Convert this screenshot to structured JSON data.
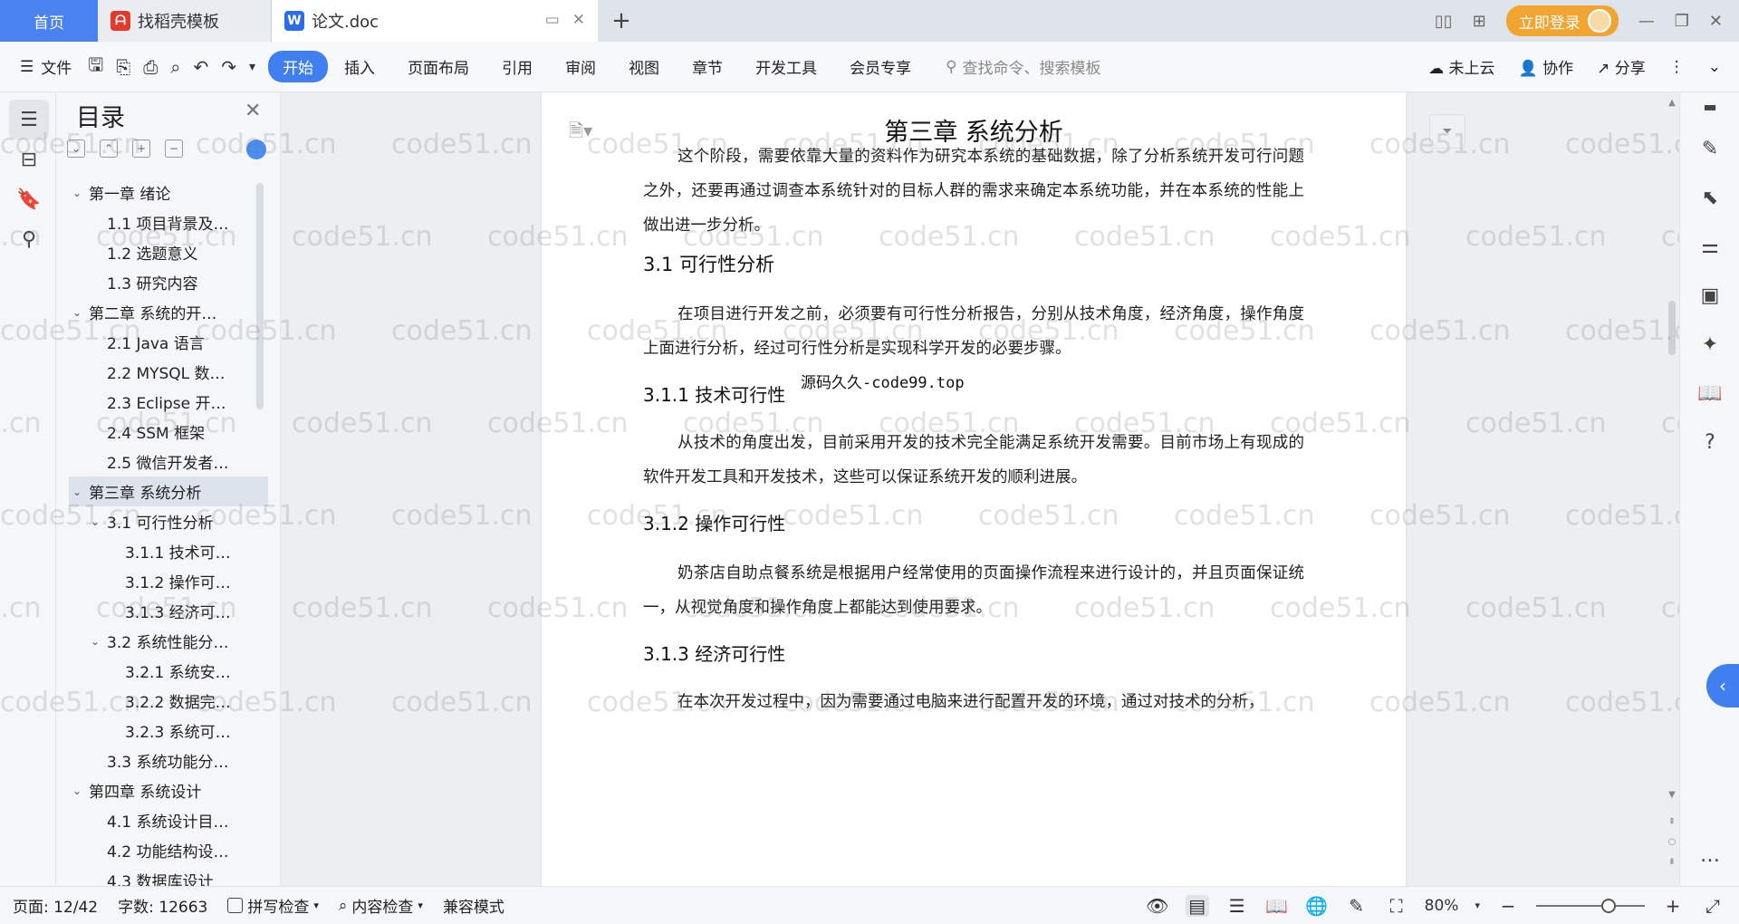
{
  "tabs": {
    "home": "首页",
    "template": "找稻壳模板",
    "doc": "论文.doc",
    "add": "+"
  },
  "titlebar": {
    "login": "立即登录"
  },
  "ribbon": {
    "file": "文件",
    "tabs": [
      "开始",
      "插入",
      "页面布局",
      "引用",
      "审阅",
      "视图",
      "章节",
      "开发工具",
      "会员专享"
    ],
    "search_placeholder": "查找命令、搜索模板",
    "cloud": "未上云",
    "collab": "协作",
    "share": "分享"
  },
  "toc": {
    "title": "目录",
    "items": [
      {
        "label": "第一章  绪论",
        "level": 1,
        "caret": "⌄"
      },
      {
        "label": "1.1  项目背景及…",
        "level": 2,
        "caret": ""
      },
      {
        "label": "1.2  选题意义",
        "level": 2,
        "caret": ""
      },
      {
        "label": "1.3  研究内容",
        "level": 2,
        "caret": ""
      },
      {
        "label": "第二章  系统的开…",
        "level": 1,
        "caret": "⌄"
      },
      {
        "label": "2.1 Java 语言",
        "level": 2,
        "caret": ""
      },
      {
        "label": "2.2 MYSQL 数…",
        "level": 2,
        "caret": ""
      },
      {
        "label": "2.3 Eclipse 开…",
        "level": 2,
        "caret": ""
      },
      {
        "label": "2.4 SSM 框架",
        "level": 2,
        "caret": ""
      },
      {
        "label": "2.5 微信开发者…",
        "level": 2,
        "caret": ""
      },
      {
        "label": "第三章  系统分析",
        "level": 1,
        "caret": "⌄",
        "selected": true
      },
      {
        "label": "3.1 可行性分析",
        "level": 2,
        "caret": "⌄"
      },
      {
        "label": "3.1.1 技术可…",
        "level": 3,
        "caret": ""
      },
      {
        "label": "3.1.2 操作可…",
        "level": 3,
        "caret": ""
      },
      {
        "label": "3.1.3 经济可…",
        "level": 3,
        "caret": ""
      },
      {
        "label": "3.2  系统性能分…",
        "level": 2,
        "caret": "⌄"
      },
      {
        "label": "3.2.1  系统安…",
        "level": 3,
        "caret": ""
      },
      {
        "label": "3.2.2  数据完…",
        "level": 3,
        "caret": ""
      },
      {
        "label": "3.2.3  系统可…",
        "level": 3,
        "caret": ""
      },
      {
        "label": "3.3 系统功能分…",
        "level": 2,
        "caret": ""
      },
      {
        "label": "第四章  系统设计",
        "level": 1,
        "caret": "⌄"
      },
      {
        "label": "4.1  系统设计目…",
        "level": 2,
        "caret": ""
      },
      {
        "label": "4.2 功能结构设…",
        "level": 2,
        "caret": ""
      },
      {
        "label": "4.3 数据库设计",
        "level": 2,
        "caret": ""
      }
    ]
  },
  "document": {
    "chapter_title": "第三章  系统分析",
    "intro": "这个阶段，需要依靠大量的资料作为研究本系统的基础数据，除了分析系统开发可行问题之外，还要再通过调查本系统针对的目标人群的需求来确定本系统功能，并在本系统的性能上做出进一步分析。",
    "h_31": "3.1 可行性分析",
    "p_31": "在项目进行开发之前，必须要有可行性分析报告，分别从技术角度，经济角度，操作角度上面进行分析，经过可行性分析是实现科学开发的必要步骤。",
    "h_311": "3.1.1 技术可行性",
    "watermark_text": "源码久久-code99.top",
    "p_311": "从技术的角度出发，目前采用开发的技术完全能满足系统开发需要。目前市场上有现成的软件开发工具和开发技术，这些可以保证系统开发的顺利进展。",
    "h_312": "3.1.2 操作可行性",
    "p_312": "奶茶店自助点餐系统是根据用户经常使用的页面操作流程来进行设计的，并且页面保证统一，从视觉角度和操作角度上都能达到使用要求。",
    "h_313": "3.1.3 经济可行性",
    "p_313": "在本次开发过程中，因为需要通过电脑来进行配置开发的环境，通过对技术的分析，"
  },
  "watermark": "code51.cn",
  "status": {
    "page": "页面: 12/42",
    "words": "字数: 12663",
    "spell": "拼写检查",
    "content": "内容检查",
    "compat": "兼容模式",
    "zoom": "80%"
  },
  "colors": {
    "accent": "#3f7ff0",
    "home_tab": "#4a82f0",
    "login": "#f1a430"
  }
}
